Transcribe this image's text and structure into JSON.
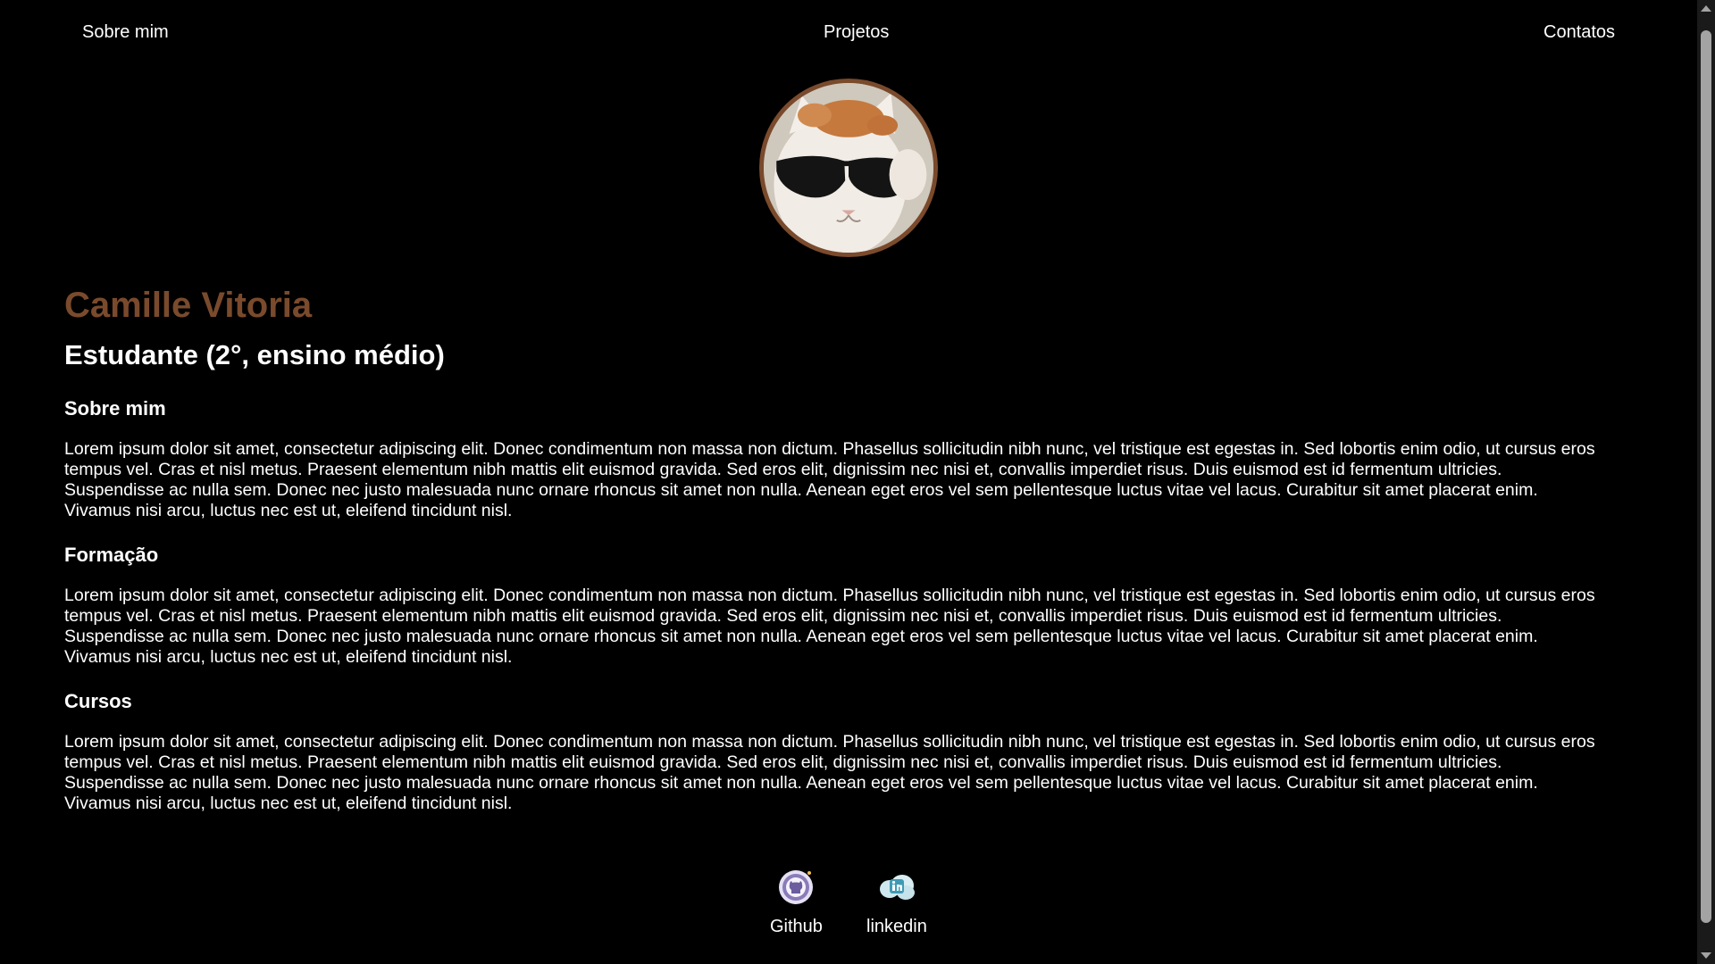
{
  "nav": {
    "about": "Sobre mim",
    "projects": "Projetos",
    "contacts": "Contatos"
  },
  "profile": {
    "avatar_icon": "cat-with-sunglasses-photo",
    "name": "Camille Vitoria",
    "role": "Estudante (2°, ensino médio)"
  },
  "sections": [
    {
      "title": "Sobre mim",
      "text": "Lorem ipsum dolor sit amet, consectetur adipiscing elit. Donec condimentum non massa non dictum. Phasellus sollicitudin nibh nunc, vel tristique est egestas in. Sed lobortis enim odio, ut cursus eros tempus vel. Cras et nisl metus. Praesent elementum nibh mattis elit euismod gravida. Sed eros elit, dignissim nec nisi et, convallis imperdiet risus. Duis euismod est id fermentum ultricies. Suspendisse ac nulla sem. Donec nec justo malesuada nunc ornare rhoncus sit amet non nulla. Aenean eget eros vel sem pellentesque luctus vitae vel lacus. Curabitur sit amet placerat enim. Vivamus nisi arcu, luctus nec est ut, eleifend tincidunt nisl."
    },
    {
      "title": "Formação",
      "text": "Lorem ipsum dolor sit amet, consectetur adipiscing elit. Donec condimentum non massa non dictum. Phasellus sollicitudin nibh nunc, vel tristique est egestas in. Sed lobortis enim odio, ut cursus eros tempus vel. Cras et nisl metus. Praesent elementum nibh mattis elit euismod gravida. Sed eros elit, dignissim nec nisi et, convallis imperdiet risus. Duis euismod est id fermentum ultricies. Suspendisse ac nulla sem. Donec nec justo malesuada nunc ornare rhoncus sit amet non nulla. Aenean eget eros vel sem pellentesque luctus vitae vel lacus. Curabitur sit amet placerat enim. Vivamus nisi arcu, luctus nec est ut, eleifend tincidunt nisl."
    },
    {
      "title": "Cursos",
      "text": "Lorem ipsum dolor sit amet, consectetur adipiscing elit. Donec condimentum non massa non dictum. Phasellus sollicitudin nibh nunc, vel tristique est egestas in. Sed lobortis enim odio, ut cursus eros tempus vel. Cras et nisl metus. Praesent elementum nibh mattis elit euismod gravida. Sed eros elit, dignissim nec nisi et, convallis imperdiet risus. Duis euismod est id fermentum ultricies. Suspendisse ac nulla sem. Donec nec justo malesuada nunc ornare rhoncus sit amet non nulla. Aenean eget eros vel sem pellentesque luctus vitae vel lacus. Curabitur sit amet placerat enim. Vivamus nisi arcu, luctus nec est ut, eleifend tincidunt nisl."
    }
  ],
  "social": {
    "github": {
      "label": "Github",
      "icon": "github-icon"
    },
    "linkedin": {
      "label": "linkedin",
      "icon": "linkedin-icon"
    }
  },
  "colors": {
    "background": "#000000",
    "text": "#ffffff",
    "accent": "#7a4a2c"
  }
}
